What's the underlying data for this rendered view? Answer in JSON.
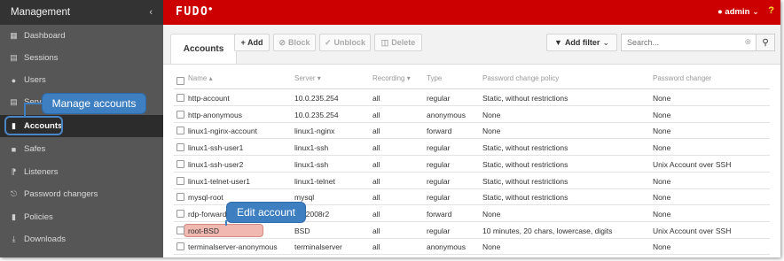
{
  "sidebar": {
    "title": "Management",
    "collapse_icon": "chevron-left-icon",
    "items": [
      {
        "label": "Dashboard",
        "icon": "dashboard-icon"
      },
      {
        "label": "Sessions",
        "icon": "film-icon"
      },
      {
        "label": "Users",
        "icon": "users-icon"
      },
      {
        "label": "Servers",
        "icon": "server-icon"
      },
      {
        "label": "Accounts",
        "icon": "book-icon"
      },
      {
        "label": "Safes",
        "icon": "safe-icon"
      },
      {
        "label": "Listeners",
        "icon": "rss-icon"
      },
      {
        "label": "Password changers",
        "icon": "sitemap-icon"
      },
      {
        "label": "Policies",
        "icon": "shield-icon"
      },
      {
        "label": "Downloads",
        "icon": "download-icon"
      }
    ],
    "active": "Accounts"
  },
  "topbar": {
    "logo": "FUDO",
    "user": "admin",
    "help": "?",
    "accent": "#cc0000"
  },
  "toolbar": {
    "tab_label": "Accounts",
    "add_label": "+ Add",
    "block_label": "Block",
    "unblock_label": "Unblock",
    "delete_label": "Delete",
    "filter_label": "Add filter",
    "search_placeholder": "Search..."
  },
  "table": {
    "columns": [
      "Name",
      "Server",
      "Recording",
      "Type",
      "Password change policy",
      "Password changer"
    ],
    "rows": [
      [
        "http-account",
        "10.0.235.254",
        "all",
        "regular",
        "Static, without restrictions",
        "None"
      ],
      [
        "http-anonymous",
        "10.0.235.254",
        "all",
        "anonymous",
        "None",
        "None"
      ],
      [
        "linux1-nginx-account",
        "linux1-nginx",
        "all",
        "forward",
        "None",
        "None"
      ],
      [
        "linux1-ssh-user1",
        "linux1-ssh",
        "all",
        "regular",
        "Static, without restrictions",
        "None"
      ],
      [
        "linux1-ssh-user2",
        "linux1-ssh",
        "all",
        "regular",
        "Static, without restrictions",
        "Unix Account over SSH"
      ],
      [
        "linux1-telnet-user1",
        "linux1-telnet",
        "all",
        "regular",
        "Static, without restrictions",
        "None"
      ],
      [
        "mysql-root",
        "mysql",
        "all",
        "regular",
        "Static, without restrictions",
        "None"
      ],
      [
        "rdp-forward",
        "win2008r2",
        "all",
        "forward",
        "None",
        "None"
      ],
      [
        "root-BSD",
        "BSD",
        "all",
        "regular",
        "10 minutes, 20 chars, lowercase, digits",
        "Unix Account over SSH"
      ],
      [
        "terminalserver-anonymous",
        "terminalserver",
        "all",
        "anonymous",
        "None",
        "None"
      ]
    ]
  },
  "callouts": {
    "manage": "Manage accounts",
    "edit": "Edit account"
  },
  "colors": {
    "callout": "#3e7fc1",
    "highlight": "#f0b8b0"
  }
}
